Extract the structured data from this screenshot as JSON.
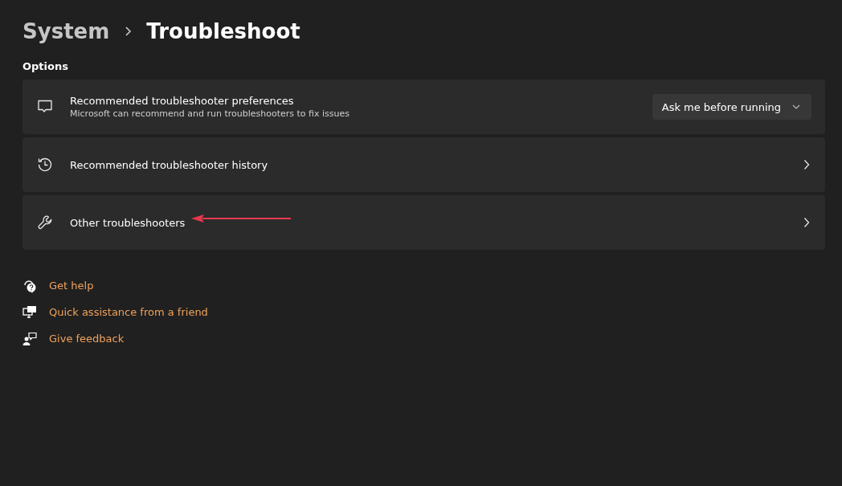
{
  "breadcrumb": [
    {
      "label": "System",
      "current": false
    },
    {
      "label": "Troubleshoot",
      "current": true
    }
  ],
  "section_title": "Options",
  "options": [
    {
      "kind": "dropdown",
      "title": "Recommended troubleshooter preferences",
      "subtitle": "Microsoft can recommend and run troubleshooters to fix issues",
      "value": "Ask me before running",
      "pointed": false
    },
    {
      "kind": "link",
      "title": "Recommended troubleshooter history",
      "pointed": false
    },
    {
      "kind": "link",
      "title": "Other troubleshooters",
      "pointed": true
    }
  ],
  "links": [
    {
      "label": "Get help"
    },
    {
      "label": "Quick assistance from a friend"
    },
    {
      "label": "Give feedback"
    }
  ]
}
